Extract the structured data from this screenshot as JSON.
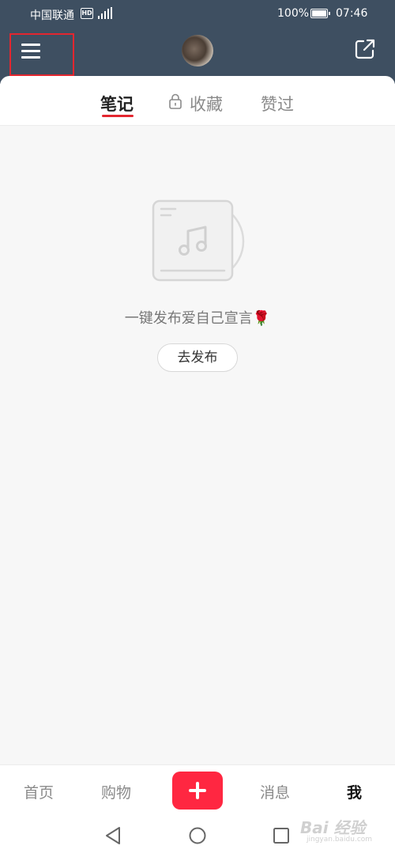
{
  "status_bar": {
    "carrier": "中国联通",
    "hd_badge": "HD",
    "battery": "100%",
    "time": "07:46"
  },
  "header": {
    "menu_icon": "hamburger-menu-icon",
    "share_icon": "share-external-icon",
    "highlight_color": "#e3262f"
  },
  "tabs": [
    {
      "label": "笔记",
      "active": true
    },
    {
      "label": "收藏",
      "active": false,
      "icon": "lock-icon"
    },
    {
      "label": "赞过",
      "active": false
    }
  ],
  "empty_state": {
    "message": "一键发布爱自己宣言🌹",
    "button": "去发布",
    "icon": "music-album-icon"
  },
  "bottom_nav": [
    {
      "label": "首页"
    },
    {
      "label": "购物"
    },
    {
      "label": "+",
      "icon": "plus-icon"
    },
    {
      "label": "消息"
    },
    {
      "label": "我",
      "active": true
    }
  ],
  "watermark": {
    "text": "Bai 经验",
    "sub": "jingyan.baidu.com"
  },
  "colors": {
    "header_bg": "#3e4f61",
    "accent": "#ff2741"
  }
}
